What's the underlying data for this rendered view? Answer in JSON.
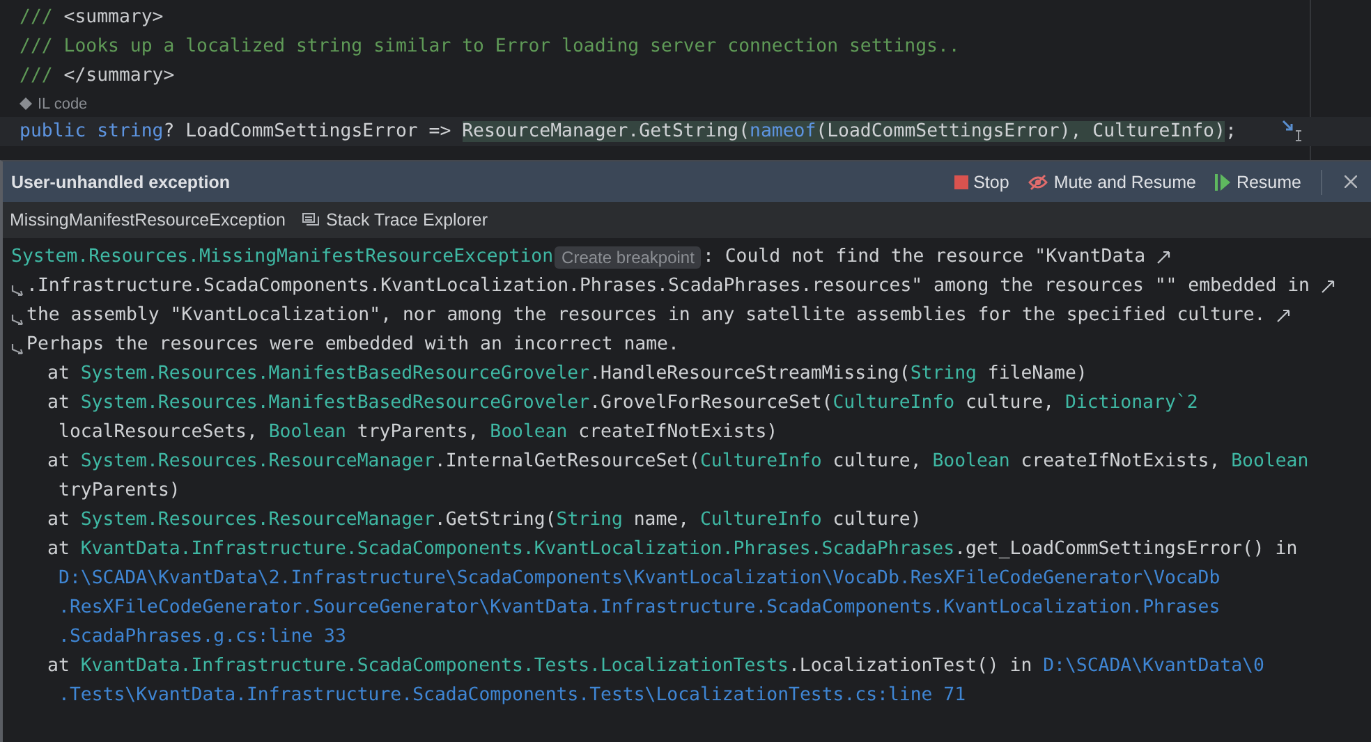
{
  "editor": {
    "lines": [
      {
        "current": false,
        "tokens": [
          {
            "kind": "comment",
            "text": "/// "
          },
          {
            "kind": "doc-tag",
            "text": "<summary>"
          }
        ]
      },
      {
        "current": false,
        "tokens": [
          {
            "kind": "comment",
            "text": "/// Looks up a localized string similar to Error loading server connection settings.."
          }
        ]
      },
      {
        "current": false,
        "tokens": [
          {
            "kind": "comment",
            "text": "/// "
          },
          {
            "kind": "doc-tag",
            "text": "</summary>"
          }
        ]
      },
      {
        "kind": "hint",
        "text": "IL code"
      },
      {
        "current": true,
        "tokens": [
          {
            "kind": "keyword",
            "text": "public "
          },
          {
            "kind": "keyword",
            "text": "string"
          },
          {
            "kind": "plain",
            "text": "? LoadCommSettingsError => "
          }
        ],
        "selection": [
          {
            "kind": "plain",
            "text": "ResourceManager.GetString("
          },
          {
            "kind": "keyword",
            "text": "nameof"
          },
          {
            "kind": "plain",
            "text": "(LoadCommSettingsError), CultureInfo)"
          }
        ],
        "after": ";"
      }
    ]
  },
  "exception_popup": {
    "title": "User-unhandled exception",
    "actions": [
      {
        "kind": "stop",
        "label": "Stop"
      },
      {
        "kind": "mute",
        "label": "Mute and Resume"
      },
      {
        "kind": "resume",
        "label": "Resume"
      },
      {
        "kind": "close"
      }
    ],
    "toolbar": [
      {
        "kind": "text",
        "label": "MissingManifestResourceException"
      },
      {
        "kind": "stack-trace",
        "label": "Stack Trace Explorer"
      }
    ],
    "message": [
      {
        "soft_wrap": true,
        "parts": [
          {
            "kind": "text",
            "tokens": [
              {
                "kind": "type",
                "text": "System.Resources.MissingManifestResourceException"
              }
            ]
          },
          {
            "kind": "button",
            "text": "Create breakpoint"
          },
          {
            "kind": "text",
            "tokens": [
              {
                "kind": "plain",
                "text": ": Could not find the resource \"KvantData"
              }
            ]
          }
        ]
      },
      {
        "soft_wrap": true,
        "parts": [
          {
            "kind": "text",
            "tokens": [
              {
                "kind": "plain",
                "text": ".Infrastructure.ScadaComponents.KvantLocalization.Phrases.ScadaPhrases.resources\" among the resources \"\" embedded in"
              }
            ]
          }
        ]
      },
      {
        "soft_wrap": true,
        "parts": [
          {
            "kind": "text",
            "tokens": [
              {
                "kind": "plain",
                "text": "the assembly \"KvantLocalization\", nor among the resources in any satellite assemblies for the specified culture."
              }
            ]
          }
        ]
      },
      {
        "soft_wrap": false,
        "parts": [
          {
            "kind": "text",
            "tokens": [
              {
                "kind": "plain",
                "text": "Perhaps the resources were embedded with an incorrect name."
              }
            ]
          }
        ]
      }
    ],
    "stack_trace": [
      {
        "kind": "frame",
        "parts": [
          {
            "kind": "text",
            "tokens": [
              {
                "kind": "plain",
                "text": "at "
              },
              {
                "kind": "type",
                "text": "System.Resources.ManifestBasedResourceGroveler"
              },
              {
                "kind": "plain",
                "text": ".HandleResourceStreamMissing("
              },
              {
                "kind": "type",
                "text": "String"
              },
              {
                "kind": "plain",
                "text": " fileName)"
              }
            ]
          }
        ]
      },
      {
        "kind": "frame",
        "parts": [
          {
            "kind": "text",
            "tokens": [
              {
                "kind": "plain",
                "text": "at "
              },
              {
                "kind": "type",
                "text": "System.Resources.ManifestBasedResourceGroveler"
              },
              {
                "kind": "plain",
                "text": ".GrovelForResourceSet("
              },
              {
                "kind": "type",
                "text": "CultureInfo"
              },
              {
                "kind": "plain",
                "text": " culture, "
              },
              {
                "kind": "type",
                "text": "Dictionary`2"
              }
            ]
          }
        ]
      },
      {
        "kind": "continuation",
        "parts": [
          {
            "kind": "text",
            "tokens": [
              {
                "kind": "plain",
                "text": "localResourceSets, "
              },
              {
                "kind": "type",
                "text": "Boolean"
              },
              {
                "kind": "plain",
                "text": " tryParents, "
              },
              {
                "kind": "type",
                "text": "Boolean"
              },
              {
                "kind": "plain",
                "text": " createIfNotExists)"
              }
            ]
          }
        ]
      },
      {
        "kind": "frame",
        "parts": [
          {
            "kind": "text",
            "tokens": [
              {
                "kind": "plain",
                "text": "at "
              },
              {
                "kind": "type",
                "text": "System.Resources.ResourceManager"
              },
              {
                "kind": "plain",
                "text": ".InternalGetResourceSet("
              },
              {
                "kind": "type",
                "text": "CultureInfo"
              },
              {
                "kind": "plain",
                "text": " culture, "
              },
              {
                "kind": "type",
                "text": "Boolean"
              },
              {
                "kind": "plain",
                "text": " createIfNotExists, "
              },
              {
                "kind": "type",
                "text": "Boolean"
              }
            ]
          }
        ]
      },
      {
        "kind": "continuation",
        "parts": [
          {
            "kind": "text",
            "tokens": [
              {
                "kind": "plain",
                "text": "tryParents)"
              }
            ]
          }
        ]
      },
      {
        "kind": "frame",
        "parts": [
          {
            "kind": "text",
            "tokens": [
              {
                "kind": "plain",
                "text": "at "
              },
              {
                "kind": "type",
                "text": "System.Resources.ResourceManager"
              },
              {
                "kind": "plain",
                "text": ".GetString("
              },
              {
                "kind": "type",
                "text": "String"
              },
              {
                "kind": "plain",
                "text": " name, "
              },
              {
                "kind": "type",
                "text": "CultureInfo"
              },
              {
                "kind": "plain",
                "text": " culture)"
              }
            ]
          }
        ]
      },
      {
        "kind": "frame",
        "parts": [
          {
            "kind": "text",
            "tokens": [
              {
                "kind": "plain",
                "text": "at "
              },
              {
                "kind": "type",
                "text": "KvantData.Infrastructure.ScadaComponents.KvantLocalization.Phrases.ScadaPhrases"
              },
              {
                "kind": "plain",
                "text": ".get_LoadCommSettingsError() in"
              }
            ]
          }
        ]
      },
      {
        "kind": "continuation",
        "parts": [
          {
            "kind": "link",
            "text": "D:\\SCADA\\KvantData\\2.Infrastructure\\ScadaComponents\\KvantLocalization\\VocaDb.ResXFileCodeGenerator\\VocaDb"
          }
        ]
      },
      {
        "kind": "continuation",
        "parts": [
          {
            "kind": "link",
            "text": ".ResXFileCodeGenerator.SourceGenerator\\KvantData.Infrastructure.ScadaComponents.KvantLocalization.Phrases"
          }
        ]
      },
      {
        "kind": "continuation",
        "parts": [
          {
            "kind": "link",
            "text": ".ScadaPhrases.g.cs:line 33"
          }
        ]
      },
      {
        "kind": "frame",
        "parts": [
          {
            "kind": "text",
            "tokens": [
              {
                "kind": "plain",
                "text": "at "
              },
              {
                "kind": "type",
                "text": "KvantData.Infrastructure.ScadaComponents.Tests.LocalizationTests"
              },
              {
                "kind": "plain",
                "text": ".LocalizationTest() in "
              }
            ]
          },
          {
            "kind": "link",
            "text": "D:\\SCADA\\KvantData\\0"
          }
        ]
      },
      {
        "kind": "continuation",
        "parts": [
          {
            "kind": "link",
            "text": ".Tests\\KvantData.Infrastructure.ScadaComponents.Tests\\LocalizationTests.cs:line 71"
          }
        ]
      }
    ]
  }
}
